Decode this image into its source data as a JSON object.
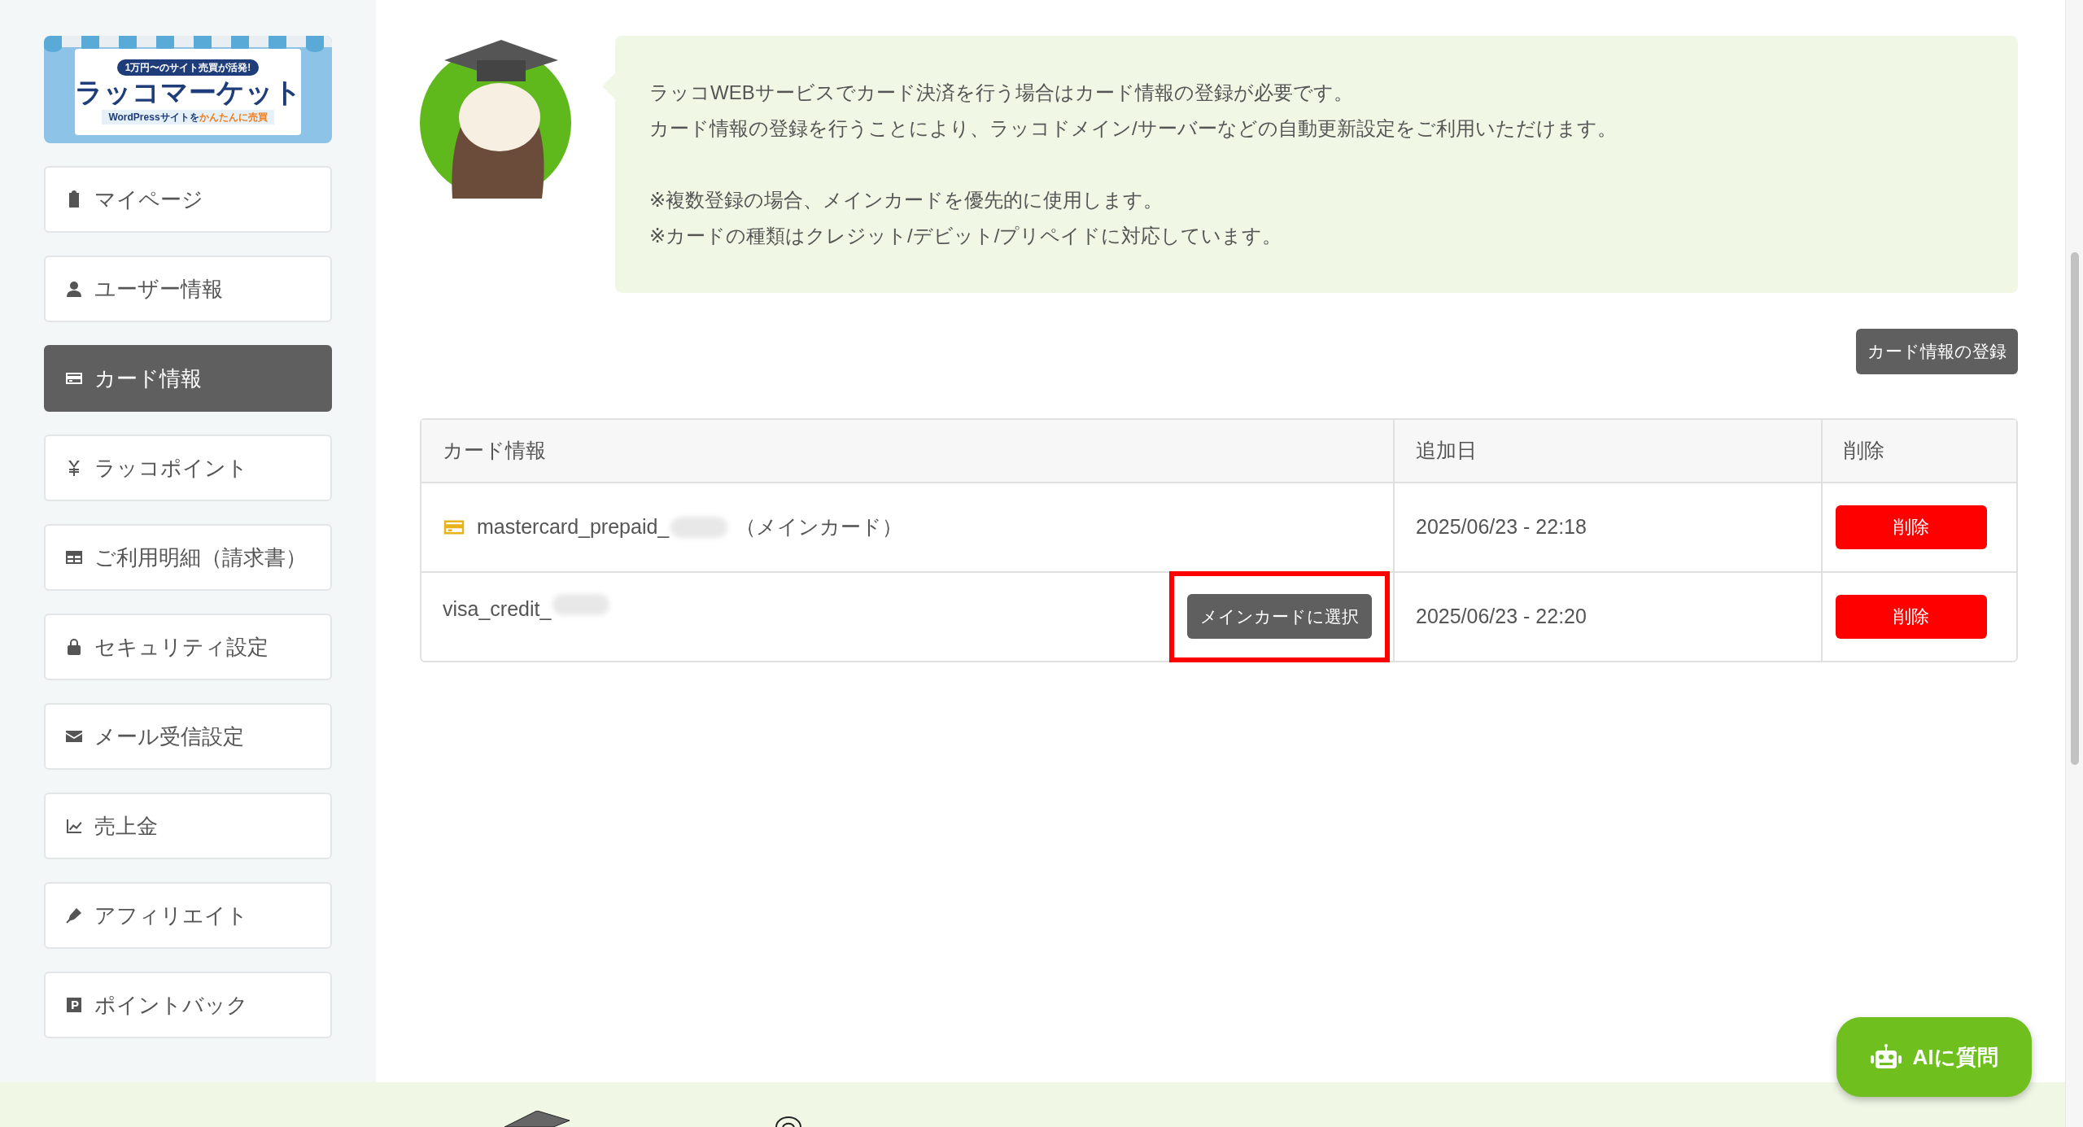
{
  "sidebar": {
    "banner": {
      "badge": "1万円〜のサイト売買が活発!",
      "title": "ラッコマーケット",
      "subtitle": "WordPressサイトを",
      "subtitle_accent": "かんたんに売買"
    },
    "items": [
      {
        "label": "マイページ",
        "selected": false
      },
      {
        "label": "ユーザー情報",
        "selected": false
      },
      {
        "label": "カード情報",
        "selected": true
      },
      {
        "label": "ラッコポイント",
        "selected": false
      },
      {
        "label": "ご利用明細（請求書）",
        "selected": false
      },
      {
        "label": "セキュリティ設定",
        "selected": false
      },
      {
        "label": "メール受信設定",
        "selected": false
      },
      {
        "label": "売上金",
        "selected": false
      },
      {
        "label": "アフィリエイト",
        "selected": false
      },
      {
        "label": "ポイントバック",
        "selected": false
      }
    ]
  },
  "notice": {
    "paragraphs": [
      [
        "ラッコWEBサービスでカード決済を行う場合はカード情報の登録が必要です。",
        "カード情報の登録を行うことにより、ラッコドメイン/サーバーなどの自動更新設定をご利用いただけます。"
      ],
      [
        "※複数登録の場合、メインカードを優先的に使用します。",
        "※カードの種類はクレジット/デビット/プリペイドに対応しています。"
      ]
    ]
  },
  "register_button": "カード情報の登録",
  "table": {
    "columns": [
      "カード情報",
      "追加日",
      "削除"
    ],
    "rows": [
      {
        "card": "mastercard_prepaid_",
        "main": true,
        "main_label": "（メインカード）",
        "added": "2025/06/23 - 22:18",
        "delete": "削除",
        "highlighted": false
      },
      {
        "card": "visa_credit_",
        "main": false,
        "select_button": "メインカードに選択",
        "added": "2025/06/23 - 22:20",
        "delete": "削除",
        "highlighted": true
      }
    ]
  },
  "ai_button": "AIに質問"
}
